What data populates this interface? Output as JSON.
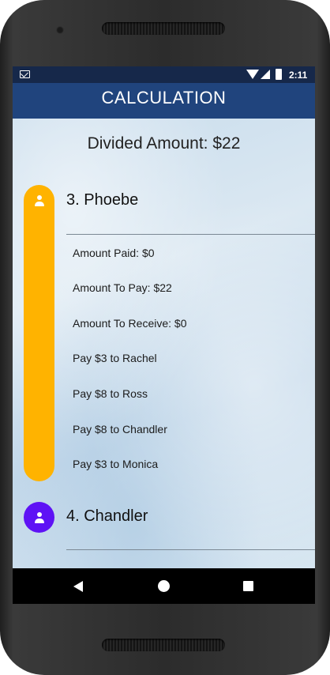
{
  "statusbar": {
    "time": "2:11"
  },
  "appbar": {
    "title": "CALCULATION"
  },
  "summary": {
    "divided_amount": "Divided Amount: $22"
  },
  "people": [
    {
      "name": "3. Phoebe",
      "avatar_color": "#ffb300",
      "expanded": true,
      "details": [
        "Amount Paid: $0",
        "Amount To Pay: $22",
        "Amount To Receive: $0",
        "Pay $3 to Rachel",
        "Pay $8 to Ross",
        "Pay $8 to Chandler",
        "Pay $3 to Monica"
      ]
    },
    {
      "name": "4. Chandler",
      "avatar_color": "#5e12f5",
      "expanded": false
    }
  ],
  "icons": {
    "status": [
      "mail-icon",
      "wifi-icon",
      "signal-icon",
      "battery-icon"
    ],
    "avatar": "person-icon",
    "nav": [
      "back-icon",
      "home-icon",
      "recents-icon"
    ]
  },
  "colors": {
    "appbar": "#20447d",
    "statusbar": "#16284a"
  }
}
